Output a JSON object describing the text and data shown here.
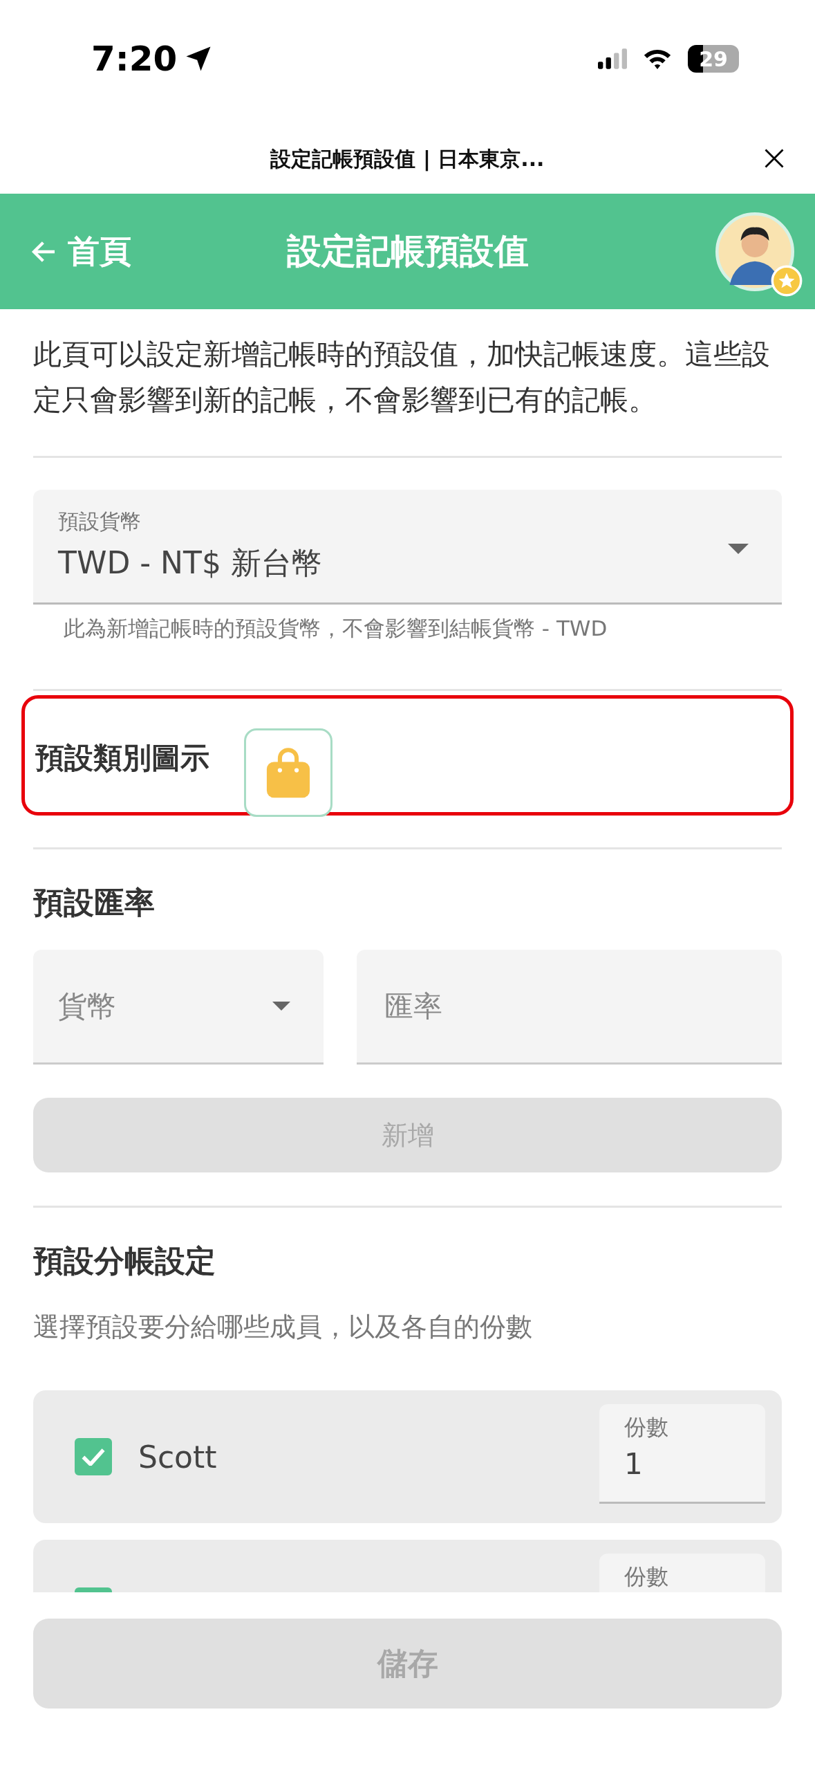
{
  "status_bar": {
    "time": "7:20",
    "battery": "29"
  },
  "browser_bar": {
    "title": "設定記帳預設值 | 日本東京..."
  },
  "header": {
    "back_label": "首頁",
    "title": "設定記帳預設值"
  },
  "intro": "此頁可以設定新增記帳時的預設值，加快記帳速度。這些設定只會影響到新的記帳，不會影響到已有的記帳。",
  "default_currency": {
    "label": "預設貨幣",
    "value": "TWD - NT$ 新台幣",
    "helper": "此為新增記帳時的預設貨幣，不會影響到結帳貨幣 - TWD"
  },
  "default_icon": {
    "label": "預設類別圖示",
    "highlighted": true
  },
  "exchange_rate": {
    "heading": "預設匯率",
    "currency_placeholder": "貨幣",
    "rate_placeholder": "匯率",
    "add_button": {
      "label": "新增",
      "disabled": true
    }
  },
  "split": {
    "heading": "預設分帳設定",
    "subtitle": "選擇預設要分給哪些成員，以及各自的份數",
    "members": [
      {
        "name": "Scott",
        "checked": true,
        "shares_label": "份數",
        "shares": "1"
      },
      {
        "checked": true,
        "shares_label": "份數"
      }
    ]
  },
  "save_button": {
    "label": "儲存",
    "disabled": true
  }
}
